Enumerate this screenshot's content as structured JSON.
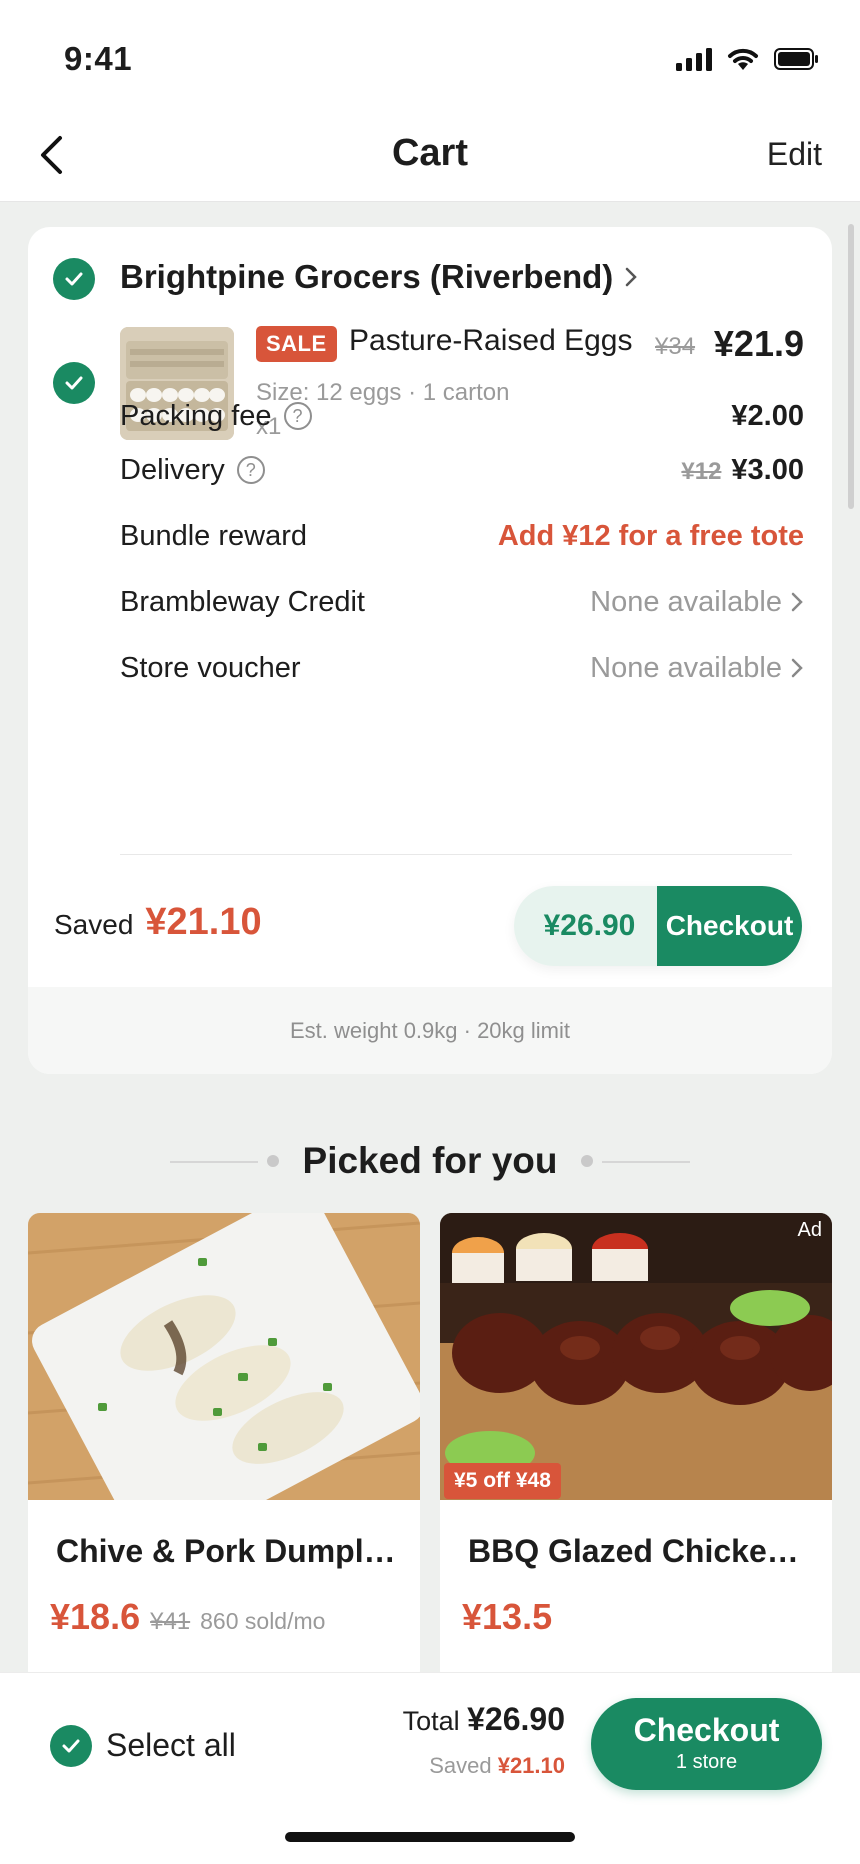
{
  "status_bar": {
    "time": "9:41"
  },
  "nav": {
    "title": "Cart",
    "edit": "Edit"
  },
  "store": {
    "name": "Brightpine Grocers (Riverbend)",
    "item": {
      "badge": "SALE",
      "name": "Pasture-Raised Eggs",
      "original_price": "¥34",
      "price": "¥21.9",
      "spec": "Size: 12 eggs · 1 carton",
      "qty": "x1"
    },
    "fees": {
      "packing_label": "Packing fee",
      "packing_value": "¥2.00",
      "delivery_label": "Delivery",
      "delivery_old": "¥12",
      "delivery_value": "¥3.00",
      "bundle_label": "Bundle reward",
      "bundle_value": "Add ¥12 for a free tote",
      "credit_label": "Brambleway Credit",
      "credit_value": "None available",
      "voucher_label": "Store voucher",
      "voucher_value": "None available"
    },
    "saved_label": "Saved",
    "saved_amount": "¥21.10",
    "pay_amount": "¥26.90",
    "checkout": "Checkout",
    "weight_note": "Est. weight 0.9kg · 20kg limit"
  },
  "picked": {
    "title": "Picked for you",
    "items": [
      {
        "name": "Chive & Pork Dumplings",
        "price": "¥18.6",
        "old": "¥41",
        "sold": "860 sold/mo"
      },
      {
        "name": "BBQ Glazed Chicken Wings",
        "price": "¥13.5",
        "ad": "Ad",
        "promo": "¥5 off ¥48"
      }
    ]
  },
  "bottom": {
    "select_all": "Select all",
    "total_label": "Total",
    "total_value": "¥26.90",
    "saved_label": "Saved",
    "saved_value": "¥21.10",
    "checkout": "Checkout",
    "checkout_sub": "1 store"
  },
  "colors": {
    "accent": "#1a8a62",
    "sale": "#d8553a"
  }
}
